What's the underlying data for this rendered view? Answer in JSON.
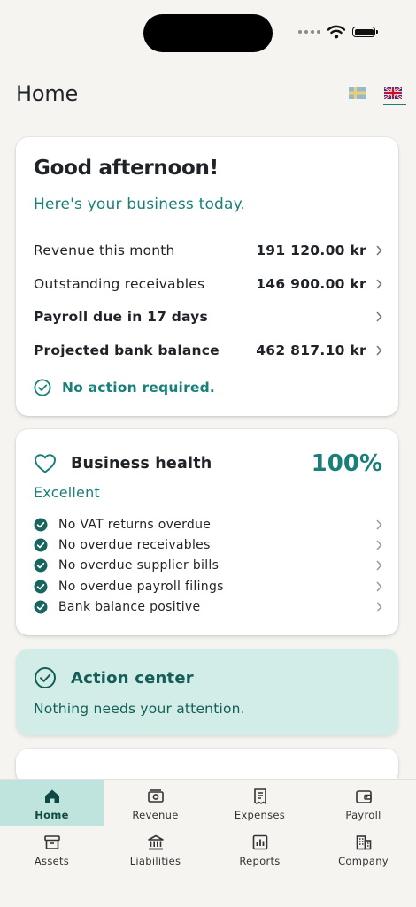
{
  "header": {
    "title": "Home"
  },
  "languages": [
    {
      "name": "Swedish",
      "active": false
    },
    {
      "name": "English",
      "active": true
    }
  ],
  "summary": {
    "greeting": "Good afternoon!",
    "subtitle": "Here's your business today.",
    "rows": [
      {
        "label": "Revenue this month",
        "value": "191 120.00 kr"
      },
      {
        "label": "Outstanding receivables",
        "value": "146 900.00 kr"
      },
      {
        "label": "Payroll due in 17 days",
        "value": ""
      },
      {
        "label": "Projected bank balance",
        "value": "462 817.10 kr"
      }
    ],
    "status": "No action required."
  },
  "health": {
    "title": "Business health",
    "percent": "100%",
    "rating": "Excellent",
    "checks": [
      "No VAT returns overdue",
      "No overdue receivables",
      "No overdue supplier bills",
      "No overdue payroll filings",
      "Bank balance positive"
    ]
  },
  "action_center": {
    "title": "Action center",
    "message": "Nothing needs your attention."
  },
  "tabs": [
    {
      "label": "Home",
      "icon": "home-icon",
      "active": true
    },
    {
      "label": "Revenue",
      "icon": "revenue-icon"
    },
    {
      "label": "Expenses",
      "icon": "receipt-icon"
    },
    {
      "label": "Payroll",
      "icon": "wallet-icon"
    },
    {
      "label": "Assets",
      "icon": "archive-box-icon"
    },
    {
      "label": "Liabilities",
      "icon": "bank-icon"
    },
    {
      "label": "Reports",
      "icon": "bar-chart-icon"
    },
    {
      "label": "Company",
      "icon": "building-icon"
    }
  ],
  "colors": {
    "accent": "#1a7f78",
    "background": "#f6f4f0",
    "action_bg": "#d2ece7",
    "active_tab": "#bfe3dd"
  }
}
